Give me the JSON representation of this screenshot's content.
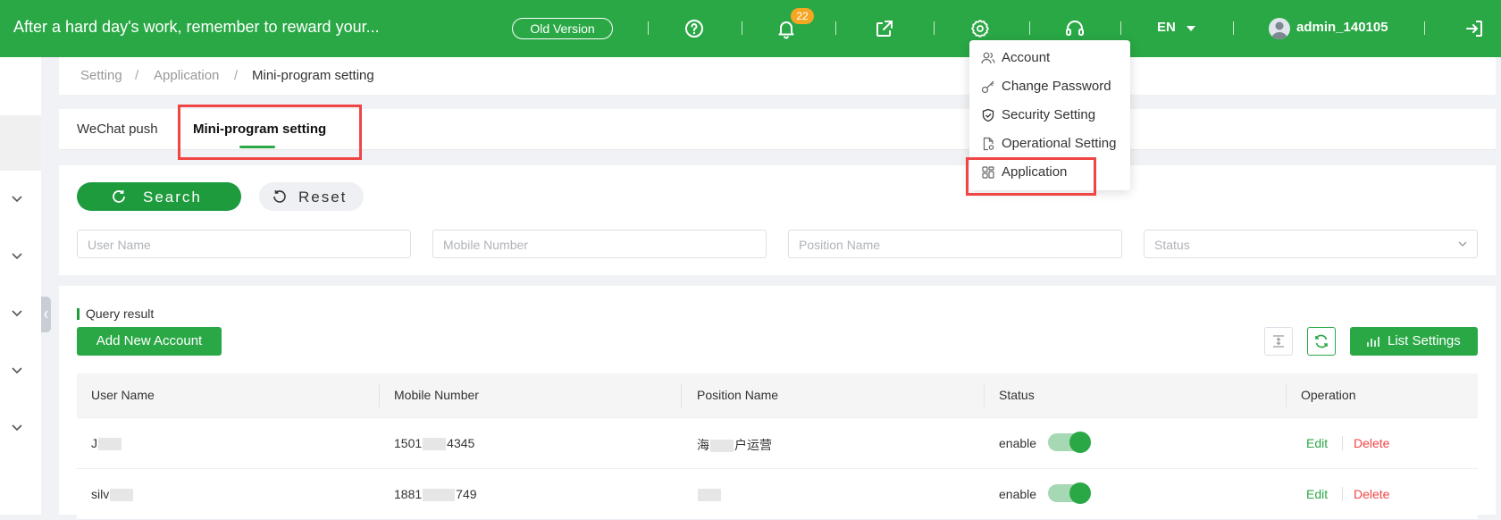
{
  "header": {
    "slogan": "After a hard day's work, remember to reward your...",
    "old_version": "Old Version",
    "notification_count": "22",
    "language": "EN",
    "username": "admin_140105"
  },
  "breadcrumb": [
    "Setting",
    "Application",
    "Mini-program setting"
  ],
  "tabs": [
    {
      "label": "WeChat push",
      "active": false
    },
    {
      "label": "Mini-program setting",
      "active": true
    }
  ],
  "search": {
    "search_label": "Search",
    "reset_label": "Reset",
    "fields": [
      {
        "placeholder": "User Name"
      },
      {
        "placeholder": "Mobile Number"
      },
      {
        "placeholder": "Position Name"
      },
      {
        "placeholder": "Status"
      }
    ]
  },
  "results": {
    "title": "Query result",
    "add_label": "Add New Account",
    "list_settings_label": "List Settings",
    "columns": [
      "User Name",
      "Mobile Number",
      "Position Name",
      "Status",
      "Operation"
    ],
    "rows": [
      {
        "user_a": "J",
        "user_b": "",
        "mobile_a": "1501",
        "mobile_b": "4345",
        "position_a": "海",
        "position_b": "户运营",
        "status": "enable",
        "edit": "Edit",
        "delete": "Delete"
      },
      {
        "user_a": "silv",
        "user_b": "",
        "mobile_a": "1881",
        "mobile_b": "749",
        "position_a": "",
        "position_b": "",
        "status": "enable",
        "edit": "Edit",
        "delete": "Delete"
      }
    ]
  },
  "settings_menu": {
    "items": [
      {
        "label": "Account",
        "icon": "users-icon"
      },
      {
        "label": "Change Password",
        "icon": "key-icon"
      },
      {
        "label": "Security Setting",
        "icon": "shield-icon"
      },
      {
        "label": "Operational Setting",
        "icon": "document-gear-icon"
      },
      {
        "label": "Application",
        "icon": "apps-icon"
      }
    ]
  },
  "colors": {
    "brand_green": "#2aa846",
    "highlight_red": "#f04545",
    "delete_red": "#f04545",
    "badge_orange": "#f5a623"
  }
}
